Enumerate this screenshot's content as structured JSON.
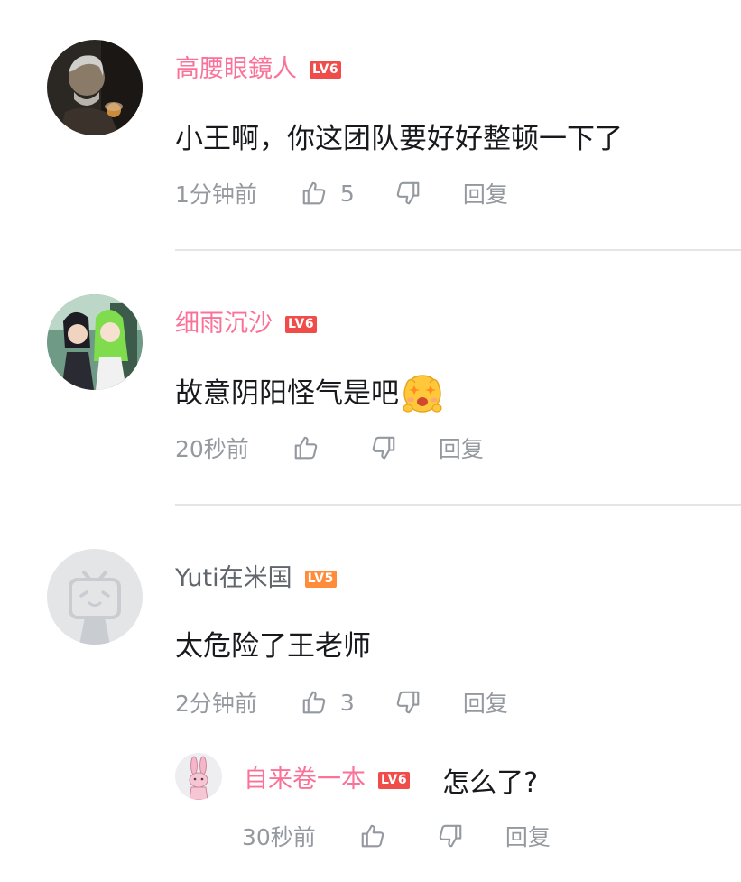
{
  "colors": {
    "username_vip": "#fb7299",
    "username_normal": "#61666d",
    "lv6_badge": "#f04c49",
    "lv5_badge": "#ff8c3b",
    "meta_text": "#9499a0",
    "divider": "#e3e5e7"
  },
  "comments": [
    {
      "username": "高腰眼鏡人",
      "level": "LV6",
      "text": "小王啊，你这团队要好好整顿一下了",
      "time": "1分钟前",
      "likes": "5",
      "reply_label": "回复",
      "avatar": "user-photo-avatar"
    },
    {
      "username": "细雨沉沙",
      "level": "LV6",
      "text": "故意阴阳怪气是吧",
      "emoji": "shocked-face-emoji",
      "time": "20秒前",
      "likes": "",
      "reply_label": "回复",
      "avatar": "anime-avatar"
    },
    {
      "username": "Yuti在米国",
      "level": "LV5",
      "text": "太危险了王老师",
      "time": "2分钟前",
      "likes": "3",
      "reply_label": "回复",
      "avatar": "default-tv-avatar"
    }
  ],
  "reply": {
    "username": "自来卷一本",
    "level": "LV6",
    "text": "怎么了?",
    "time": "30秒前",
    "reply_label": "回复",
    "avatar": "bunny-avatar"
  },
  "icons": {
    "like": "thumbs-up-icon",
    "dislike": "thumbs-down-icon"
  }
}
